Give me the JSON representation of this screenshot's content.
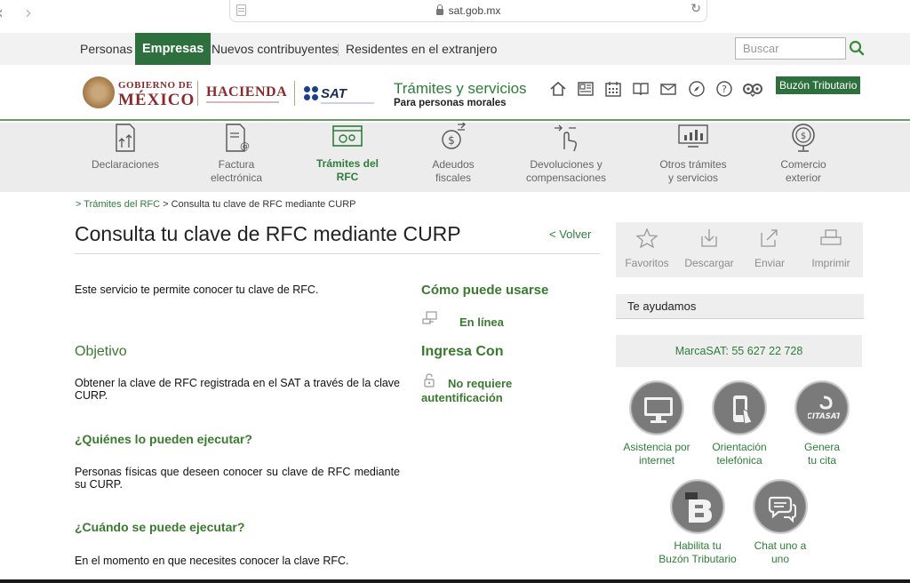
{
  "browser": {
    "url": "sat.gob.mx"
  },
  "topnav": {
    "items": [
      "Personas",
      "Empresas",
      "Nuevos contribuyentes",
      "Residentes en el extranjero"
    ],
    "search_placeholder": "Buscar"
  },
  "header": {
    "gob_line1": "GOBIERNO DE",
    "gob_line2": "MÉXICO",
    "hacienda": "HACIENDA",
    "sat": "SAT",
    "tramites_title": "Trámites y servicios",
    "tramites_sub": "Para personas morales",
    "icons": [
      "home-icon",
      "newspaper-icon",
      "calendar-icon",
      "book-icon",
      "mail-icon",
      "compass-icon",
      "help-icon",
      "owl-icon"
    ],
    "buzon": "Buzón Tributario"
  },
  "categories": [
    {
      "line1": "Declaraciones",
      "line2": ""
    },
    {
      "line1": "Factura",
      "line2": "electrónica"
    },
    {
      "line1": "Trámites del",
      "line2": "RFC"
    },
    {
      "line1": "Adeudos",
      "line2": "fiscales"
    },
    {
      "line1": "Devoluciones y",
      "line2": "compensaciones"
    },
    {
      "line1": "Otros trámites",
      "line2": "y servicios"
    },
    {
      "line1": "Comercio",
      "line2": "exterior"
    }
  ],
  "breadcrumb": {
    "prefix": "> ",
    "link": "Trámites del RFC",
    "sep": " > ",
    "current": "Consulta tu clave de RFC mediante CURP"
  },
  "content": {
    "title": "Consulta tu clave de RFC mediante CURP",
    "volver": "< Volver",
    "intro": "Este servicio te permite conocer tu clave de RFC.",
    "objetivo_heading": "Objetivo",
    "objetivo_text": "Obtener la clave de RFC registrada en el SAT a través de la clave CURP.",
    "quienes_heading": "¿Quiénes lo pueden ejecutar?",
    "quienes_text": "Personas físicas que deseen conocer su clave de RFC mediante su CURP.",
    "cuando_heading": "¿Cuándo se puede ejecutar?",
    "cuando_text": "En el momento en que necesites conocer la clave RFC.",
    "como_heading": "Cómo puede usarse",
    "como_value": "En línea",
    "ingresa_heading": "Ingresa Con",
    "ingresa_value_line1": "No requiere",
    "ingresa_value_line2": "autentificación"
  },
  "sidebar": {
    "tools": [
      "Favoritos",
      "Descargar",
      "Enviar",
      "Imprimir"
    ],
    "help_title": "Te ayudamos",
    "marca": "MarcaSAT: 55 627 22 728",
    "contacts": [
      {
        "line1": "Asistencia por",
        "line2": "internet",
        "icon": "computer-icon"
      },
      {
        "line1": "Orientación",
        "line2": "telefónica",
        "icon": "phone-icon"
      },
      {
        "line1": "Genera",
        "line2": "tu cita",
        "icon": "citasat-icon",
        "logo_text": "CITASAT"
      },
      {
        "line1": "Habilita tu",
        "line2": "Buzón Tributario",
        "icon": "buzon-b-icon"
      },
      {
        "line1": "Chat uno a",
        "line2": "uno",
        "icon": "chat-icon"
      }
    ]
  },
  "colors": {
    "green_dark": "#2e6f3e",
    "green_text": "#2e7d3a",
    "maroon": "#8b2a2e"
  }
}
